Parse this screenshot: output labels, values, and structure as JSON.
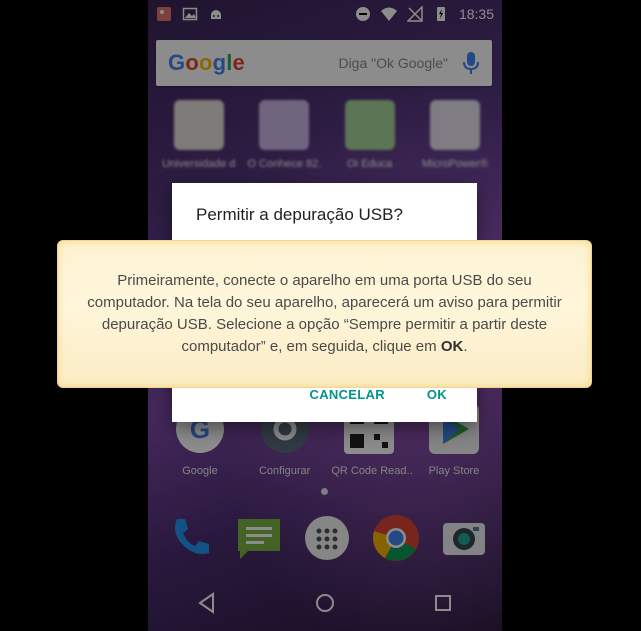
{
  "status_bar": {
    "time": "18:35"
  },
  "search": {
    "placeholder": "Diga \"Ok Google\""
  },
  "apps_row1": [
    {
      "label": "Universidade d..."
    },
    {
      "label": "O Conhece 82..."
    },
    {
      "label": "Oi Educa"
    },
    {
      "label": "MicroPower®"
    }
  ],
  "dialog": {
    "title": "Permitir a depuração USB?",
    "cancel_label": "CANCELAR",
    "ok_label": "OK"
  },
  "callout": {
    "text": "Primeiramente, conecte o aparelho em uma porta USB do seu computador. Na tela do seu aparelho, aparecerá um aviso para permitir depuração USB. Selecione a opção “Sempre permitir a partir deste computador” e, em seguida, clique em ",
    "emphasis": "OK",
    "end": "."
  },
  "apps_row2": [
    {
      "label": "Google"
    },
    {
      "label": "Configurar"
    },
    {
      "label": "QR Code Read.."
    },
    {
      "label": "Play Store"
    }
  ],
  "colors": {
    "accent": "#009688",
    "callout_bg": "#fdf2d0"
  }
}
